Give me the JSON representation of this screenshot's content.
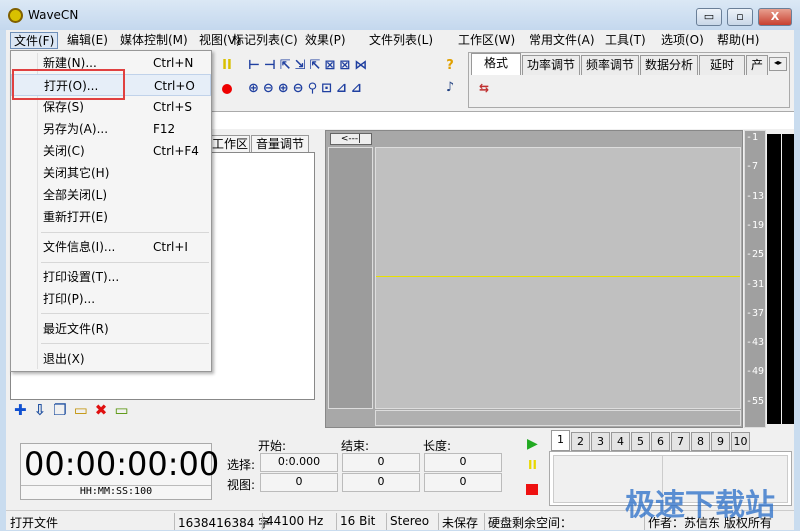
{
  "window": {
    "title": "WaveCN",
    "minimize": "▭",
    "maximize": "▫",
    "close": "X"
  },
  "menu": [
    "文件(F)",
    "编辑(E)",
    "媒体控制(M)",
    "视图(V)",
    "标记列表(C)",
    "效果(P)",
    "文件列表(L)",
    "工作区(W)",
    "常用文件(A)",
    "工具(T)",
    "选项(O)",
    "帮助(H)"
  ],
  "file_menu": [
    {
      "label": "新建(N)...",
      "shortcut": "Ctrl+N"
    },
    {
      "label": "打开(O)...",
      "shortcut": "Ctrl+O"
    },
    {
      "label": "保存(S)",
      "shortcut": "Ctrl+S"
    },
    {
      "label": "另存为(A)...",
      "shortcut": "F12"
    },
    {
      "label": "关闭(C)",
      "shortcut": "Ctrl+F4"
    },
    {
      "label": "关闭其它(H)",
      "shortcut": ""
    },
    {
      "label": "全部关闭(L)",
      "shortcut": ""
    },
    {
      "label": "重新打开(E)",
      "shortcut": ""
    },
    {
      "label": "文件信息(I)...",
      "shortcut": "Ctrl+I"
    },
    {
      "label": "打印设置(T)...",
      "shortcut": ""
    },
    {
      "label": "打印(P)...",
      "shortcut": ""
    },
    {
      "label": "最近文件(R)",
      "shortcut": ""
    },
    {
      "label": "退出(X)",
      "shortcut": ""
    }
  ],
  "effect_tabs": [
    "格式",
    "功率调节",
    "频率调节",
    "数据分析",
    "延时",
    "产"
  ],
  "left_tabs": [
    "工作区",
    "音量调节"
  ],
  "wave": {
    "scroll_button": "<---|"
  },
  "scale": [
    "-1",
    "-7",
    "-13",
    "-19",
    "-25",
    "-31",
    "-37",
    "-43",
    "-49",
    "-55"
  ],
  "timer": {
    "value": "00:00:00:00",
    "format": "HH:MM:SS:100"
  },
  "selection": {
    "headers": [
      "开始:",
      "结束:",
      "长度:"
    ],
    "rows": [
      {
        "label": "选择:",
        "values": [
          "0:0.000",
          "0",
          "0"
        ]
      },
      {
        "label": "视图:",
        "values": [
          "0",
          "0",
          "0"
        ]
      }
    ]
  },
  "number_tabs": [
    "1",
    "2",
    "3",
    "4",
    "5",
    "6",
    "7",
    "8",
    "9",
    "10"
  ],
  "status": [
    "打开文件",
    "1638416384 字",
    "44100 Hz",
    "16 Bit",
    "Stereo",
    "未保存",
    "硬盘剩余空间：",
    "作者：苏信东 版权所有"
  ],
  "watermark": "极速下载站",
  "colors": {
    "accent": "#e04040",
    "play": "#22aa22",
    "stop": "#ee1111",
    "pause": "#e8d800",
    "wave_line": "#e8e000"
  }
}
